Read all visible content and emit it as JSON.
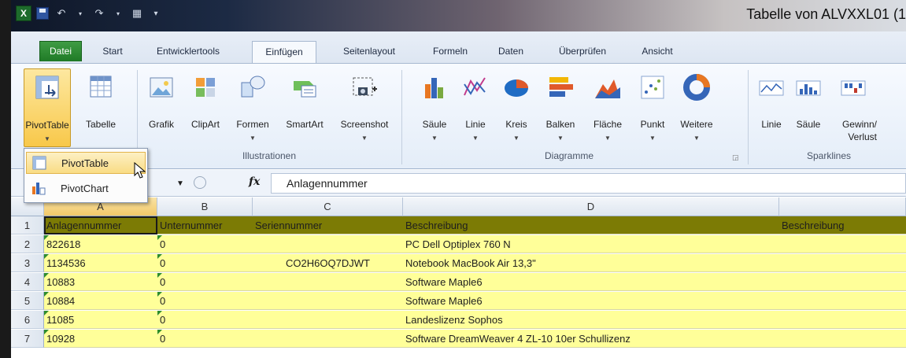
{
  "window": {
    "title": "Tabelle von ALVXXL01 (1"
  },
  "qat": {
    "app_icon": "excel-icon",
    "logo_letter": "X"
  },
  "tabs": [
    {
      "label": "Datei"
    },
    {
      "label": "Start"
    },
    {
      "label": "Entwicklertools"
    },
    {
      "label": "Einfügen"
    },
    {
      "label": "Seitenlayout"
    },
    {
      "label": "Formeln"
    },
    {
      "label": "Daten"
    },
    {
      "label": "Überprüfen"
    },
    {
      "label": "Ansicht"
    }
  ],
  "ribbon": {
    "buttons": {
      "pivottable": "PivotTable",
      "tabelle": "Tabelle",
      "grafik": "Grafik",
      "clipart": "ClipArt",
      "formen": "Formen",
      "smartart": "SmartArt",
      "screenshot": "Screenshot",
      "saeule": "Säule",
      "linie": "Linie",
      "kreis": "Kreis",
      "balken": "Balken",
      "flaeche": "Fläche",
      "punkt": "Punkt",
      "weitere": "Weitere",
      "sp_linie": "Linie",
      "sp_saeule": "Säule",
      "sp_gewinn1": "Gewinn/",
      "sp_gewinn2": "Verlust"
    },
    "groups": {
      "illustrationen": "Illustrationen",
      "diagramme": "Diagramme",
      "sparklines": "Sparklines"
    }
  },
  "dropdown": {
    "item1": "PivotTable",
    "item2": "PivotChart",
    "item1_underline": "t",
    "item2_underline": "C"
  },
  "formula": {
    "fx": "fx",
    "value": "Anlagennummer"
  },
  "grid": {
    "columns": [
      "A",
      "B",
      "C",
      "D"
    ],
    "rows": [
      {
        "n": "1",
        "a": "Anlagennummer",
        "b": "Unternummer",
        "c": "Seriennummer",
        "d": "Beschreibung",
        "e": "Beschreibung"
      },
      {
        "n": "2",
        "a": "822618",
        "b": "0",
        "c": "",
        "d": "PC Dell Optiplex 760 N",
        "e": ""
      },
      {
        "n": "3",
        "a": "1134536",
        "b": "0",
        "c": "CO2H6OQ7DJWT",
        "d": "Notebook MacBook Air 13,3\"",
        "e": ""
      },
      {
        "n": "4",
        "a": "10883",
        "b": "0",
        "c": "",
        "d": "Software Maple6",
        "e": ""
      },
      {
        "n": "5",
        "a": "10884",
        "b": "0",
        "c": "",
        "d": "Software Maple6",
        "e": ""
      },
      {
        "n": "6",
        "a": "11085",
        "b": "0",
        "c": "",
        "d": "Landeslizenz Sophos",
        "e": ""
      },
      {
        "n": "7",
        "a": "10928",
        "b": "0",
        "c": "",
        "d": "Software DreamWeaver 4 ZL-10 10er Schullizenz",
        "e": ""
      }
    ]
  },
  "colors": {
    "header_row": "#7c7b05",
    "data_row": "#ffff99",
    "file_tab": "#2f8c35",
    "accent": "#f8c84a"
  }
}
